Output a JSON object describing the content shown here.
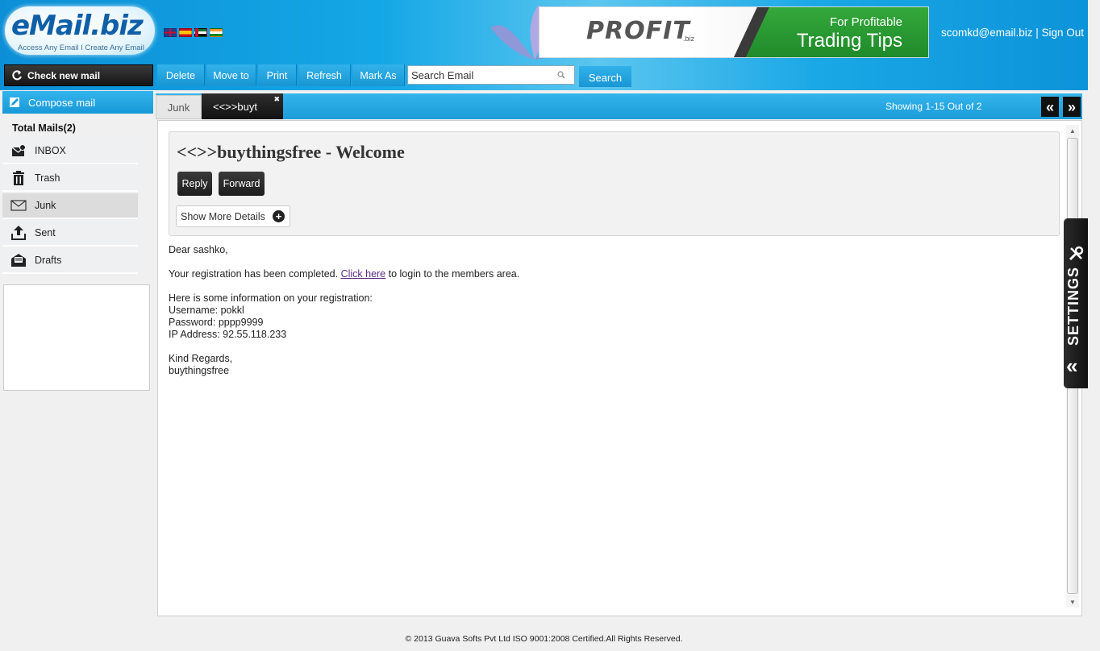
{
  "header": {
    "logo_text": "eMail.biz",
    "tagline": "Access Any Email I Create Any Email",
    "flags": [
      "uk-flag",
      "spain-flag",
      "uae-flag",
      "india-flag"
    ],
    "banner": {
      "brand": "PROFIT",
      "brand_suffix": ".biz",
      "line1": "For Profitable",
      "line2": "Trading Tips"
    },
    "user_email": "scomkd@email.biz",
    "separator": " | ",
    "sign_out": "Sign Out"
  },
  "toolbar": {
    "check_mail": "Check new mail",
    "delete": "Delete",
    "move_to": "Move to",
    "print": "Print",
    "refresh": "Refresh",
    "mark_as": "Mark As",
    "search_placeholder": "Search Email",
    "search_button": "Search"
  },
  "sidebar": {
    "compose": "Compose mail",
    "total_mails": "Total Mails(2)",
    "folders": [
      {
        "label": "INBOX",
        "icon": "inbox-icon"
      },
      {
        "label": "Trash",
        "icon": "trash-icon"
      },
      {
        "label": "Junk",
        "icon": "junk-envelope-icon"
      },
      {
        "label": "Sent",
        "icon": "sent-upload-icon"
      },
      {
        "label": "Drafts",
        "icon": "drafts-icon"
      }
    ],
    "active_folder": "Junk"
  },
  "tabs": {
    "folder_tab": "Junk",
    "message_tab": "<<>>buyt",
    "close_glyph": "✖",
    "showing": "Showing 1-15 Out of 2",
    "prev": "«",
    "next": "»"
  },
  "message": {
    "subject": "<<>>buythingsfree - Welcome",
    "reply": "Reply",
    "forward": "Forward",
    "show_more": "Show More Details",
    "greeting": "Dear sashko,",
    "line1_before": "Your registration has been completed. ",
    "line1_link": "Click here",
    "line1_after": " to login to the members area.",
    "info_intro": "Here is some information on your registration:",
    "username": "Username: pokkl",
    "password": "Password: pppp9999",
    "ip": "IP Address: 92.55.118.233",
    "closing": "Kind Regards,",
    "signature": "buythingsfree"
  },
  "settings": {
    "label": "SETTINGS",
    "chevron": "«"
  },
  "footer": {
    "text": "© 2013 Guava Softs Pvt Ltd ISO 9001:2008 Certified.All Rights Reserved."
  },
  "colors": {
    "header_blue": "#14a7e6",
    "toolbar_blue": "#1896d4",
    "dark_button": "#1e1e1e",
    "link_purple": "#5b2a86"
  }
}
